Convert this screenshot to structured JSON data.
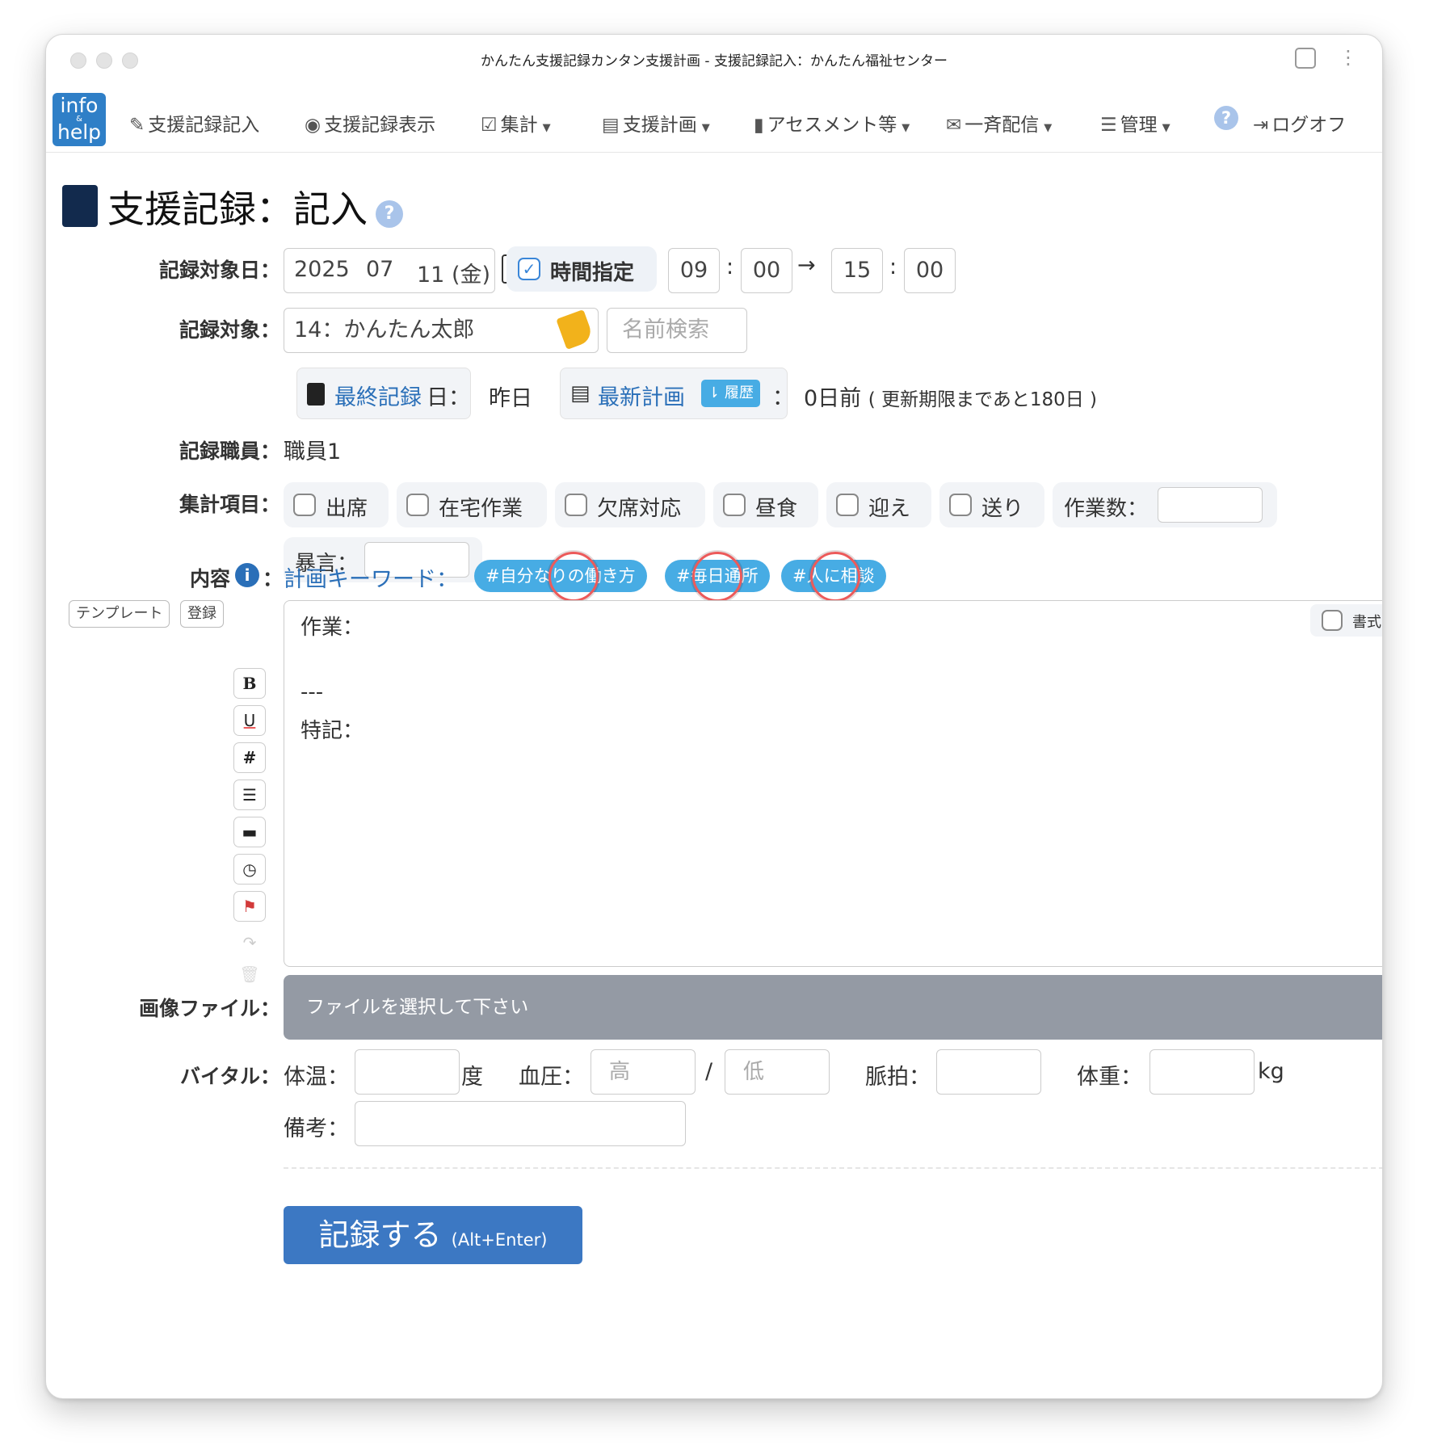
{
  "window": {
    "title": "かんたん支援記録カンタン支援計画 - 支援記録記入：かんたん福祉センター"
  },
  "navbar": {
    "logo_top": "info",
    "logo_mid": "&",
    "logo_bottom": "help",
    "items": [
      {
        "label": "支援記録記入",
        "icon": "pencil-icon"
      },
      {
        "label": "支援記録表示",
        "icon": "eye-icon"
      },
      {
        "label": "集計",
        "icon": "check-square-icon"
      },
      {
        "label": "支援計画",
        "icon": "list-alt-icon"
      },
      {
        "label": "アセスメント等",
        "icon": "file-icon"
      },
      {
        "label": "一斉配信",
        "icon": "envelope-icon"
      },
      {
        "label": "管理",
        "icon": "list-icon"
      }
    ],
    "logoff": "ログオフ"
  },
  "page": {
    "title": "支援記録：記入"
  },
  "date_row": {
    "label": "記録対象日：",
    "year": "2025",
    "month": "07",
    "day": "11 (金)",
    "time_toggle_label": "時間指定",
    "start_hour": "09",
    "start_min": "00",
    "arrow": "→",
    "end_hour": "15",
    "end_min": "00",
    "colon": ":"
  },
  "target_row": {
    "label": "記録対象：",
    "value": "14：かんたん太郎",
    "search_placeholder": "名前検索"
  },
  "info_row": {
    "last_record_link": "最終記録",
    "last_record_suffix": "日：",
    "last_record_value": "昨日",
    "latest_plan_link": "最新計画",
    "history_badge": "履歴",
    "latest_plan_sep": "：",
    "latest_plan_value": "0日前",
    "latest_plan_note": "( 更新期限まであと180日 )"
  },
  "staff_row": {
    "label": "記録職員：",
    "value": "職員1"
  },
  "tally_row": {
    "label": "集計項目：",
    "checkboxes": [
      "出席",
      "在宅作業",
      "欠席対応",
      "昼食",
      "迎え",
      "送り"
    ],
    "work_count_label": "作業数：",
    "abuse_label": "暴言："
  },
  "content_row": {
    "label": "内容",
    "sep": "：",
    "keywords_label": "計画キーワード：",
    "keywords": [
      "#自分なりの働き方",
      "#毎日通所",
      "#人に相談"
    ]
  },
  "editor": {
    "template_button": "テンプレート",
    "register_button": "登録",
    "format_label": "書式",
    "toolbar": [
      "B",
      "U",
      "#"
    ],
    "lines": [
      "作業：",
      "---",
      "特記："
    ]
  },
  "file_row": {
    "label": "画像ファイル：",
    "placeholder": "ファイルを選択して下さい"
  },
  "vital_row": {
    "label": "バイタル：",
    "temp_label": "体温：",
    "temp_unit": "度",
    "bp_label": "血圧：",
    "bp_high_placeholder": "高",
    "bp_slash": "/",
    "bp_low_placeholder": "低",
    "pulse_label": "脈拍：",
    "weight_label": "体重：",
    "weight_unit": "kg",
    "note_label": "備考："
  },
  "submit": {
    "label": "記録する",
    "shortcut": "(Alt+Enter)"
  },
  "colors": {
    "accent": "#3c78c3",
    "keyword_bg": "#47ace4",
    "link": "#2a6fb8",
    "file_bar": "#949aa4",
    "ring": "#ec5a5a"
  }
}
